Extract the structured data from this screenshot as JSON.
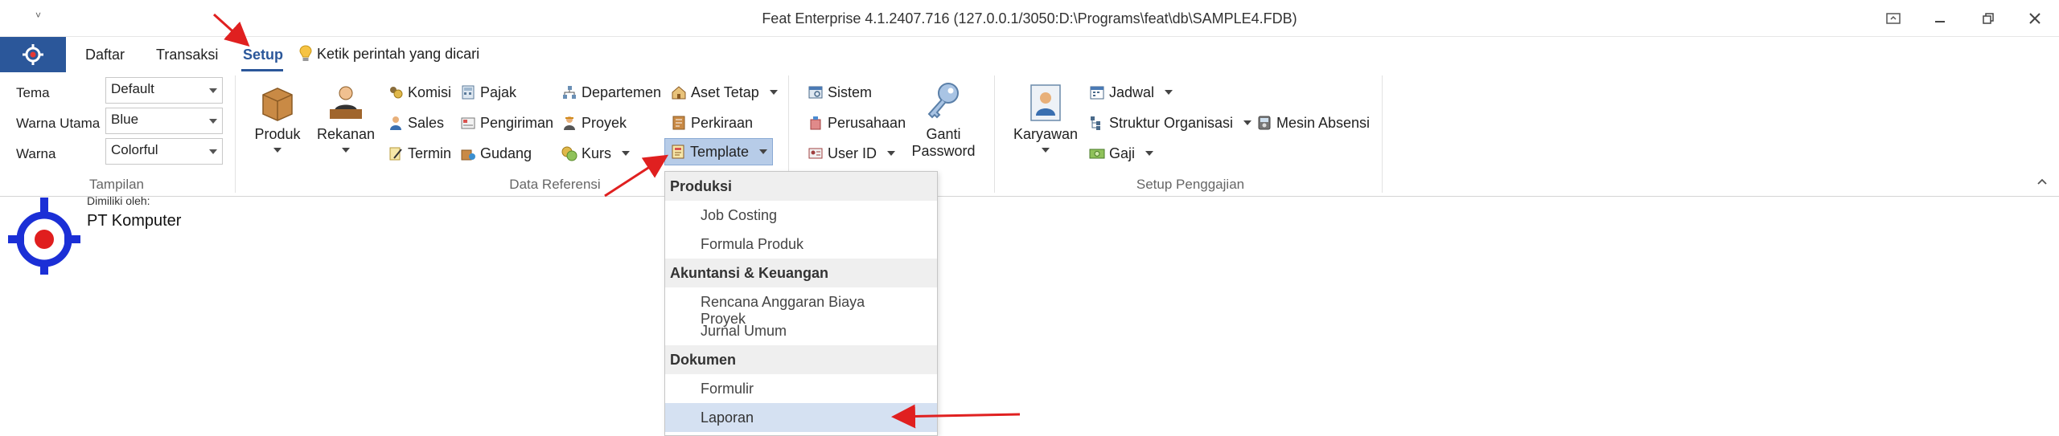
{
  "window": {
    "title": "Feat Enterprise 4.1.2407.716 (127.0.0.1/3050:D:\\Programs\\feat\\db\\SAMPLE4.FDB)",
    "quick_access": "˅",
    "controls": [
      "⬚",
      "—",
      "❐",
      "✕"
    ]
  },
  "tabs": {
    "items": [
      "Daftar",
      "Transaksi",
      "Setup"
    ],
    "search_hint": "Ketik perintah yang dicari"
  },
  "tampilan": {
    "group_label": "Tampilan",
    "tema_label": "Tema",
    "tema_value": "Default",
    "warna_utama_label": "Warna Utama",
    "warna_utama_value": "Blue",
    "warna_label": "Warna",
    "warna_value": "Colorful"
  },
  "data_referensi": {
    "group_label": "Data Referensi",
    "produk": "Produk",
    "rekanan": "Rekanan",
    "komisi": "Komisi",
    "sales": "Sales",
    "termin": "Termin",
    "pajak": "Pajak",
    "pengiriman": "Pengiriman",
    "gudang": "Gudang",
    "departemen": "Departemen",
    "proyek": "Proyek",
    "kurs": "Kurs",
    "aset_tetap": "Aset Tetap",
    "perkiraan": "Perkiraan",
    "template": "Template"
  },
  "sistem_group": {
    "sistem": "Sistem",
    "perusahaan": "Perusahaan",
    "user_id": "User ID",
    "ganti_password_1": "Ganti",
    "ganti_password_2": "Password"
  },
  "penggajian": {
    "group_label": "Setup Penggajian",
    "karyawan": "Karyawan",
    "jadwal": "Jadwal",
    "struktur": "Struktur Organisasi",
    "gaji": "Gaji",
    "mesin_absensi": "Mesin Absensi"
  },
  "content": {
    "owned_by": "Dimiliki oleh:",
    "company": "PT Komputer"
  },
  "template_menu": {
    "sections": [
      {
        "heading": "Produksi",
        "items": [
          "Job Costing",
          "Formula Produk"
        ]
      },
      {
        "heading": "Akuntansi & Keuangan",
        "items": [
          "Rencana Anggaran Biaya Proyek",
          "Jurnal Umum"
        ]
      },
      {
        "heading": "Dokumen",
        "items": [
          "Formulir",
          "Laporan"
        ]
      }
    ],
    "selected": "Laporan"
  },
  "colors": {
    "accent": "#2b579a",
    "annotation_arrow": "#e02020",
    "selection": "#d5e1f2"
  }
}
